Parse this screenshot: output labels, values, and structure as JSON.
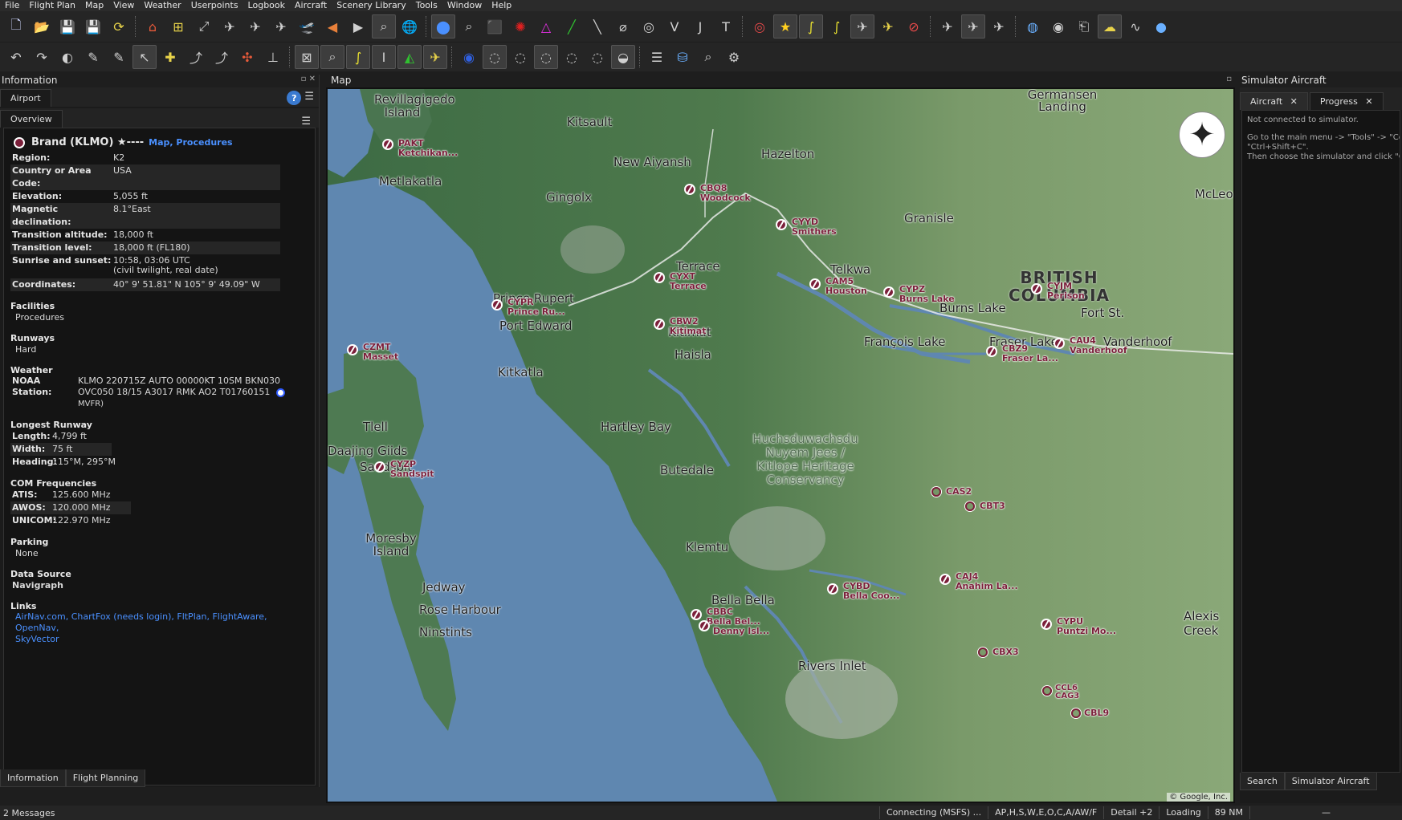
{
  "menu": [
    "File",
    "Flight Plan",
    "Map",
    "View",
    "Weather",
    "Userpoints",
    "Logbook",
    "Aircraft",
    "Scenery Library",
    "Tools",
    "Window",
    "Help"
  ],
  "info": {
    "dock_title": "Information",
    "tab_top": "Airport",
    "tab_sub": "Overview",
    "airport_name": "Brand (KLMO) ★----",
    "airport_links": "Map, Procedures",
    "rows": [
      {
        "k": "Region:",
        "v": "K2"
      },
      {
        "k": "Country or Area Code:",
        "v": "USA"
      },
      {
        "k": "Elevation:",
        "v": "5,055 ft"
      },
      {
        "k": "Magnetic declination:",
        "v": "8.1°East"
      },
      {
        "k": "Transition altitude:",
        "v": "18,000 ft"
      },
      {
        "k": "Transition level:",
        "v": "18,000 ft (FL180)"
      },
      {
        "k": "Sunrise and sunset:",
        "v": "10:58, 03:06 UTC"
      },
      {
        "k": "",
        "v": "(civil twilight, real date)"
      },
      {
        "k": "Coordinates:",
        "v": "40° 9' 51.81\" N 105° 9' 49.09\" W"
      }
    ],
    "facilities_title": "Facilities",
    "facilities": "Procedures",
    "runways_title": "Runways",
    "runways": "Hard",
    "weather_title": "Weather",
    "noaa_label": "NOAA Station:",
    "noaa_value": "KLMO 220715Z AUTO 00000KT 10SM BKN030 OVC050 18/15 A3017 RMK AO2 T01760151",
    "noaa_flag": "MVFR)",
    "longest_title": "Longest Runway",
    "longest": [
      {
        "k": "Length:",
        "v": "4,799 ft"
      },
      {
        "k": "Width:",
        "v": "75 ft"
      },
      {
        "k": "Heading:",
        "v": "115°M, 295°M"
      }
    ],
    "com_title": "COM Frequencies",
    "com": [
      {
        "k": "ATIS:",
        "v": "125.600 MHz"
      },
      {
        "k": "AWOS:",
        "v": "120.000 MHz"
      },
      {
        "k": "UNICOM:",
        "v": "122.970 MHz"
      }
    ],
    "parking_title": "Parking",
    "parking": "None",
    "source_title": "Data Source",
    "source": "Navigraph",
    "links_title": "Links",
    "links_1": "AirNav.com, ChartFox (needs login), FltPlan, FlightAware, OpenNav,",
    "links_2": "SkyVector",
    "bottom_tabs": [
      "Information",
      "Flight Planning"
    ]
  },
  "map": {
    "title": "Map",
    "copyright": "© Google, Inc.",
    "labels": [
      "Revillagigedo Island",
      "Kitsault",
      "New Aiyansh",
      "Hazelton",
      "Metlakatla",
      "Gingolx",
      "Granisle",
      "Telkwa",
      "BRITISH COLUMBIA",
      "Terrace",
      "Prince Rupert",
      "Port Edward",
      "Burns Lake",
      "François Lake",
      "Fraser Lake",
      "Kitimat",
      "Kitkatla",
      "Haisla",
      "Hartley Bay",
      "Huchsduwachsdu Nuyem Jees / Kitlope Heritage Conservancy",
      "Butedale",
      "Daajing Giids",
      "Sandspit",
      "Moresby Island",
      "Klemtu",
      "Jedway",
      "Rose Harbour",
      "Ninstints",
      "Bella Bella",
      "Rivers Inlet",
      "Alexis Creek",
      "Germansen Landing",
      "McLeod",
      "Tlell",
      "Fort St.",
      "Vanderhoof"
    ],
    "airports": [
      {
        "code": "PAKT",
        "name": "Ketchikan..."
      },
      {
        "code": "CBQ8",
        "name": "Woodcock"
      },
      {
        "code": "CYYD",
        "name": "Smithers"
      },
      {
        "code": "CYXT",
        "name": "Terrace"
      },
      {
        "code": "CYPR",
        "name": "Prince Ru..."
      },
      {
        "code": "CAM5",
        "name": "Houston"
      },
      {
        "code": "CYPZ",
        "name": "Burns Lake"
      },
      {
        "code": "CYJM",
        "name": "Perison"
      },
      {
        "code": "CBW2",
        "name": "Kitimat"
      },
      {
        "code": "CZMT",
        "name": "Masset"
      },
      {
        "code": "CBZ9",
        "name": "Fraser La..."
      },
      {
        "code": "CAU4",
        "name": "Vanderhoof"
      },
      {
        "code": "CYZP",
        "name": "Sandspit"
      },
      {
        "code": "CAS2",
        "name": ""
      },
      {
        "code": "CBT3",
        "name": ""
      },
      {
        "code": "CAJ4",
        "name": "Anahim La..."
      },
      {
        "code": "CYBD",
        "name": "Bella Coo..."
      },
      {
        "code": "CBBC",
        "name": "Bella Bel..."
      },
      {
        "code": "",
        "name": "Denny Isl..."
      },
      {
        "code": "CYPU",
        "name": "Puntzi Mo..."
      },
      {
        "code": "CBX3",
        "name": ""
      },
      {
        "code": "CCL6",
        "name": ""
      },
      {
        "code": "CAG3",
        "name": ""
      },
      {
        "code": "CBL9",
        "name": ""
      }
    ]
  },
  "sim": {
    "dock_title": "Simulator Aircraft",
    "tabs": [
      "Aircraft",
      "Progress"
    ],
    "lines": [
      "Not connected to simulator.",
      "",
      "Go to the main menu -> \"Tools\" -> \"Con",
      "\"Ctrl+Shift+C\".",
      "Then choose the simulator and click \"Co"
    ],
    "bottom_tabs": [
      "Search",
      "Simulator Aircraft"
    ]
  },
  "status": {
    "messages": "2 Messages",
    "connect": "Connecting (MSFS) ...",
    "flags": "AP,H,S,W,E,O,C,A/AW/F",
    "detail": "Detail +2",
    "loading": "Loading",
    "distance": "89 NM",
    "extra": "—"
  }
}
